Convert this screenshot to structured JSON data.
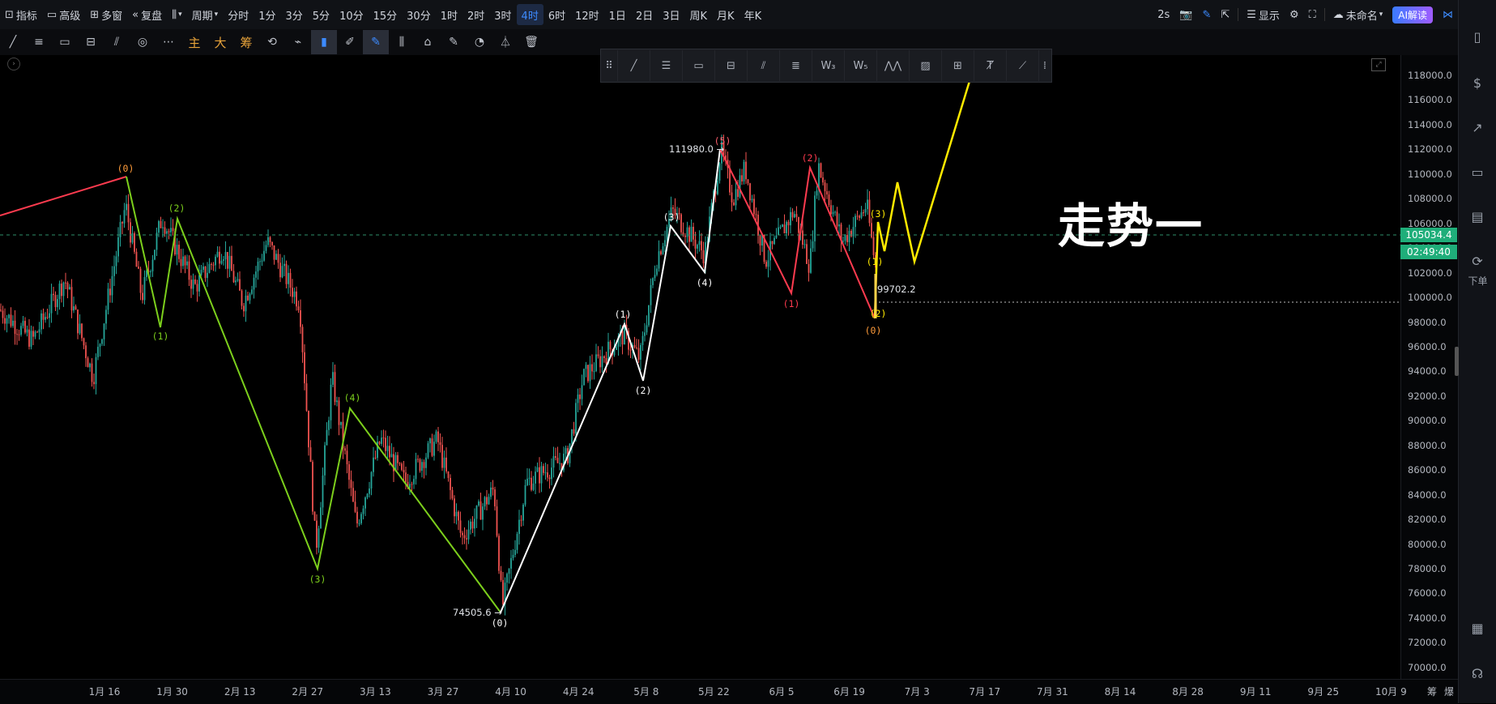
{
  "topbar": {
    "items": [
      "指标",
      "高级",
      "多窗",
      "复盘",
      "",
      "周期",
      "分时",
      "1分",
      "3分",
      "5分",
      "10分",
      "15分",
      "30分",
      "1时",
      "2时",
      "3时",
      "4时",
      "6时",
      "12时",
      "1日",
      "2日",
      "3日",
      "周K",
      "月K",
      "年K"
    ],
    "active_index": 16,
    "right": {
      "refresh": "2s",
      "display": "显示",
      "name": "未命名",
      "ai": "AI解读"
    }
  },
  "toolbar2": {
    "cn_buttons": [
      "主",
      "大",
      "筹"
    ]
  },
  "right_panel": {
    "order_label": "下单"
  },
  "chart": {
    "title_overlay": "走势一",
    "last_price": "105034.4",
    "countdown": "02:49:40",
    "high_label": "111980.0",
    "low_label": "74505.6",
    "level_label": "99702.2",
    "y_ticks": [
      "118000.0",
      "116000.0",
      "114000.0",
      "112000.0",
      "110000.0",
      "108000.0",
      "106000.0",
      "104000.0",
      "102000.0",
      "100000.0",
      "98000.0",
      "96000.0",
      "94000.0",
      "92000.0",
      "90000.0",
      "88000.0",
      "86000.0",
      "84000.0",
      "82000.0",
      "80000.0",
      "78000.0",
      "76000.0",
      "74000.0",
      "72000.0",
      "70000.0"
    ],
    "x_ticks": [
      "1月 16",
      "1月 30",
      "2月 13",
      "2月 27",
      "3月 13",
      "3月 27",
      "4月 10",
      "4月 24",
      "5月 8",
      "5月 22",
      "6月 5",
      "6月 19",
      "7月 3",
      "7月 17",
      "7月 31",
      "8月 14",
      "8月 28",
      "9月 11",
      "9月 25",
      "10月 9"
    ],
    "x_right": [
      "筹",
      "爆"
    ],
    "colors": {
      "bg": "#000000",
      "up": "#26a69a",
      "down": "#ef5350",
      "red_wave": "#ff3b4f",
      "green_wave": "#7ccf1c",
      "white_wave": "#ffffff",
      "yellow_wave": "#ffea00",
      "orange_label": "#ff9c3b"
    },
    "wave_labels": {
      "orange": [
        "(0)",
        "(5)",
        "(0)"
      ],
      "green": [
        "(2)",
        "(1)",
        "(4)",
        "(3)"
      ],
      "white": [
        "(3)",
        "(4)",
        "(1)",
        "(2)",
        "(0)"
      ],
      "red": [
        "(2)",
        "(1)"
      ],
      "yellow": [
        "(3)",
        "(1)",
        "(2)"
      ]
    }
  }
}
